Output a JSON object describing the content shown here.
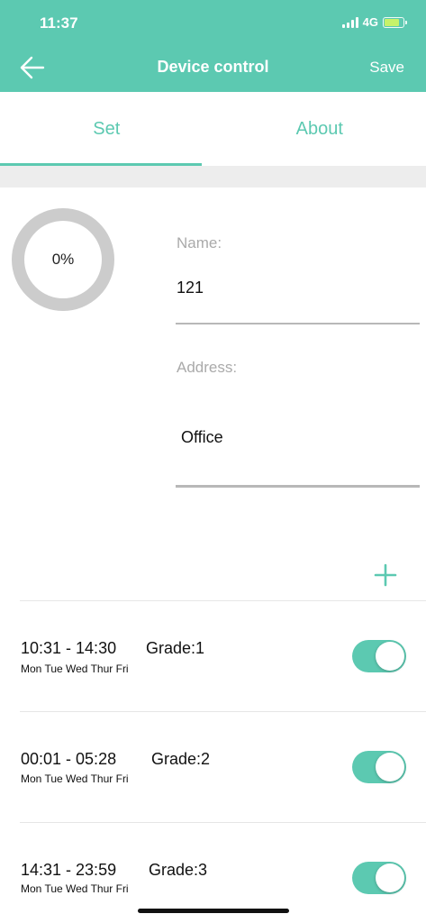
{
  "status_bar": {
    "time": "11:37",
    "network": "4G",
    "battery_level": 0.8,
    "icons": [
      "signal-icon",
      "battery-charging-icon"
    ]
  },
  "nav": {
    "title": "Device control",
    "save_label": "Save",
    "back_icon": "arrow-left-icon"
  },
  "tabs": [
    {
      "label": "Set",
      "active": true
    },
    {
      "label": "About",
      "active": false
    }
  ],
  "progress": {
    "value_text": "0%",
    "value": 0
  },
  "form": {
    "name_label": "Name:",
    "name_value": "121",
    "address_label": "Address:",
    "address_value": "Office"
  },
  "add_icon": "plus-icon",
  "schedules": [
    {
      "time": "10:31 - 14:30",
      "grade": "Grade:1",
      "days": "Mon Tue Wed Thur Fri",
      "enabled": true
    },
    {
      "time": "00:01 - 05:28",
      "grade": "Grade:2",
      "days": "Mon Tue Wed Thur Fri",
      "enabled": true
    },
    {
      "time": "14:31 - 23:59",
      "grade": "Grade:3",
      "days": "Mon Tue Wed Thur Fri",
      "enabled": true
    }
  ],
  "colors": {
    "accent": "#5cc9b1",
    "ring_track": "#cccccc",
    "label_gray": "#aaaaaa"
  }
}
